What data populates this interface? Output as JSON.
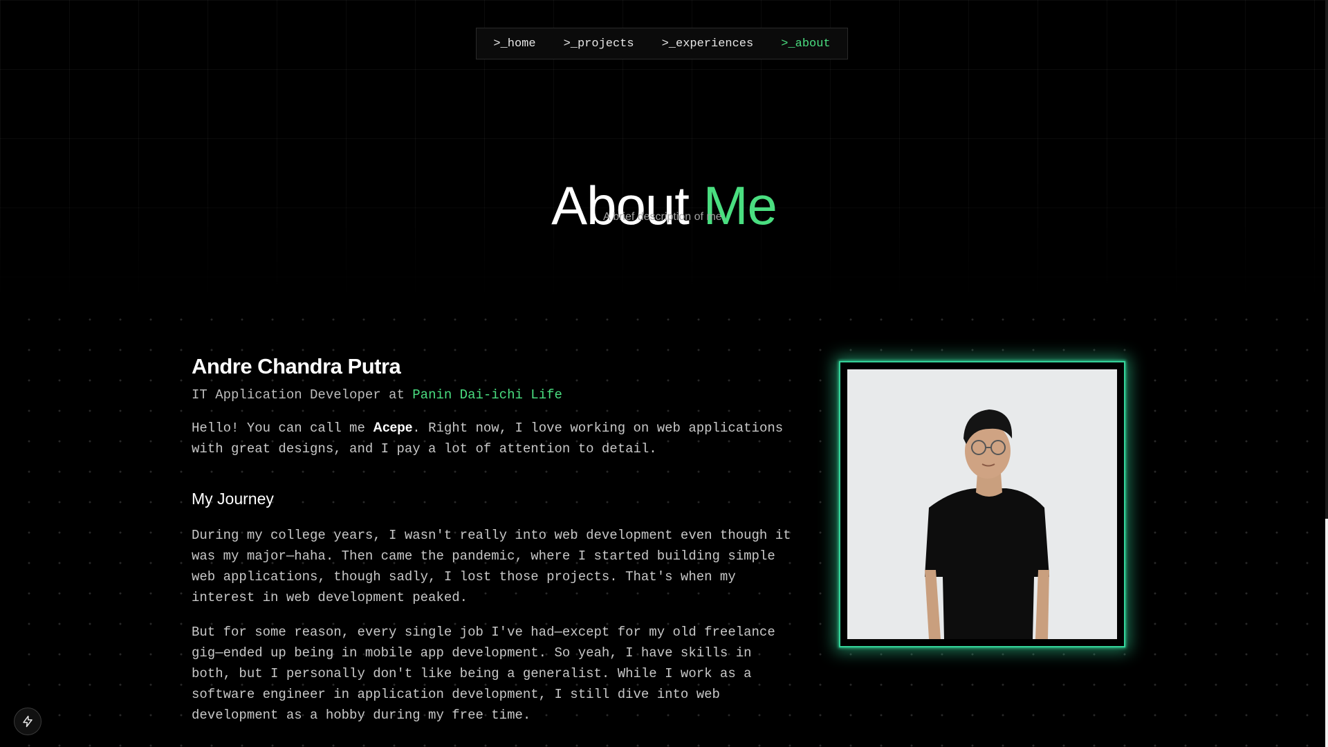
{
  "nav": {
    "items": [
      {
        "label": ">_home",
        "active": false
      },
      {
        "label": ">_projects",
        "active": false
      },
      {
        "label": ">_experiences",
        "active": false
      },
      {
        "label": ">_about",
        "active": true
      }
    ]
  },
  "header": {
    "title_main": "About",
    "title_accent": "Me",
    "subtitle": "A brief description of me."
  },
  "profile": {
    "name": "Andre Chandra Putra",
    "role_prefix": "IT Application Developer at",
    "company": "Panin Dai-ichi Life",
    "intro_before": "Hello! You can call me ",
    "nickname": "Acepe",
    "intro_after": ". Right now, I love working on web applications with great designs, and I pay a lot of attention to detail."
  },
  "journey": {
    "title": "My Journey",
    "paragraph_1": "During my college years, I wasn't really into web development even though it was my major—haha. Then came the pandemic, where I started building simple web applications, though sadly, I lost those projects. That's when my interest in web development peaked.",
    "paragraph_2": "But for some reason, every single job I've had—except for my old freelance gig—ended up being in mobile app development. So yeah, I have skills in both, but I personally don't like being a generalist. While I work as a software engineer in application development, I still dive into web development as a hobby during my free time."
  },
  "colors": {
    "accent": "#4ade80",
    "frame_glow": "#34d399",
    "background": "#000000"
  },
  "icons": {
    "badge": "lightning-bolt-icon"
  }
}
